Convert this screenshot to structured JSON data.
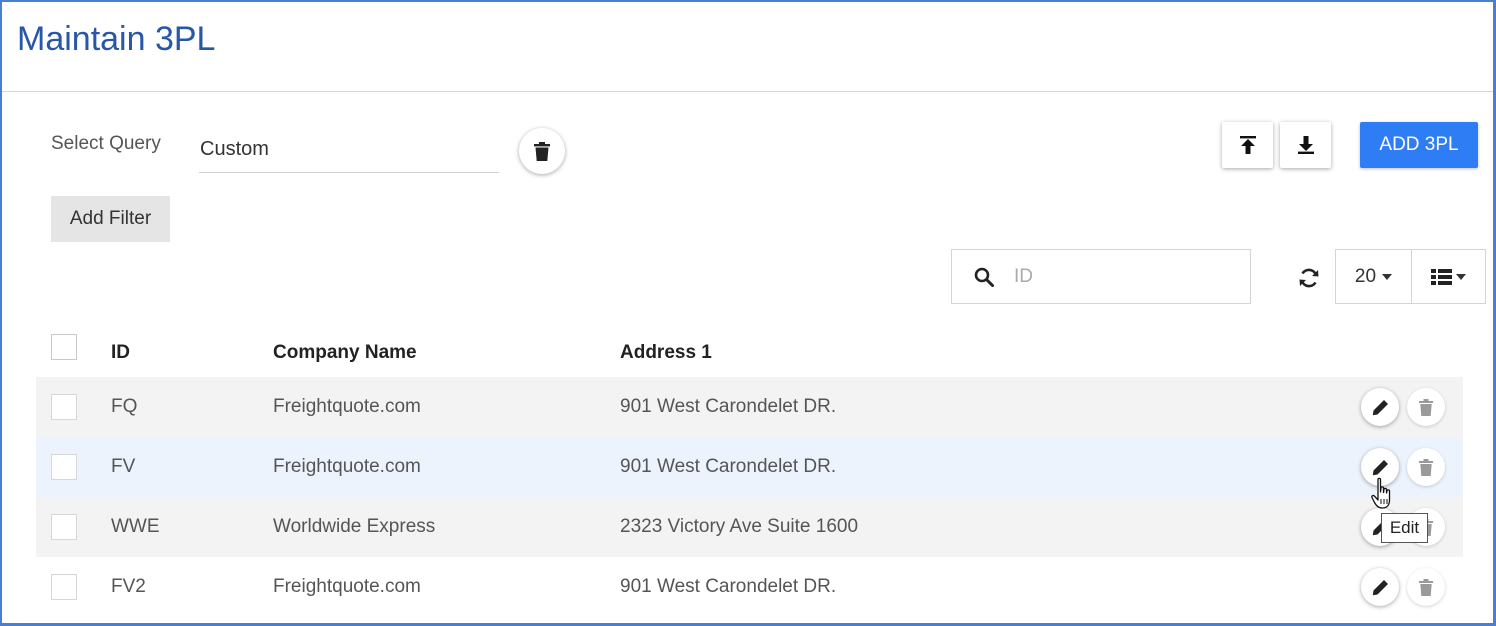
{
  "page": {
    "title": "Maintain 3PL"
  },
  "query": {
    "label": "Select Query",
    "value": "Custom",
    "delete_icon": "trash-icon"
  },
  "filters": {
    "add_filter_label": "Add Filter"
  },
  "toolbar": {
    "upload_icon": "upload-icon",
    "download_icon": "download-icon",
    "add_label": "ADD 3PL",
    "accent_color": "#2f7df5"
  },
  "search": {
    "placeholder": "ID",
    "value": ""
  },
  "table_controls": {
    "page_size": "20",
    "refresh_icon": "refresh-icon",
    "columns_icon": "list-columns-icon"
  },
  "table": {
    "columns": [
      "ID",
      "Company Name",
      "Address 1"
    ],
    "rows": [
      {
        "id": "FQ",
        "company_name": "Freightquote.com",
        "address1": "901 West Carondelet DR."
      },
      {
        "id": "FV",
        "company_name": "Freightquote.com",
        "address1": "901 West Carondelet DR."
      },
      {
        "id": "WWE",
        "company_name": "Worldwide Express",
        "address1": "2323 Victory Ave Suite 1600"
      },
      {
        "id": "FV2",
        "company_name": "Freightquote.com",
        "address1": "901 West Carondelet DR."
      }
    ]
  },
  "tooltip": {
    "text": "Edit"
  }
}
